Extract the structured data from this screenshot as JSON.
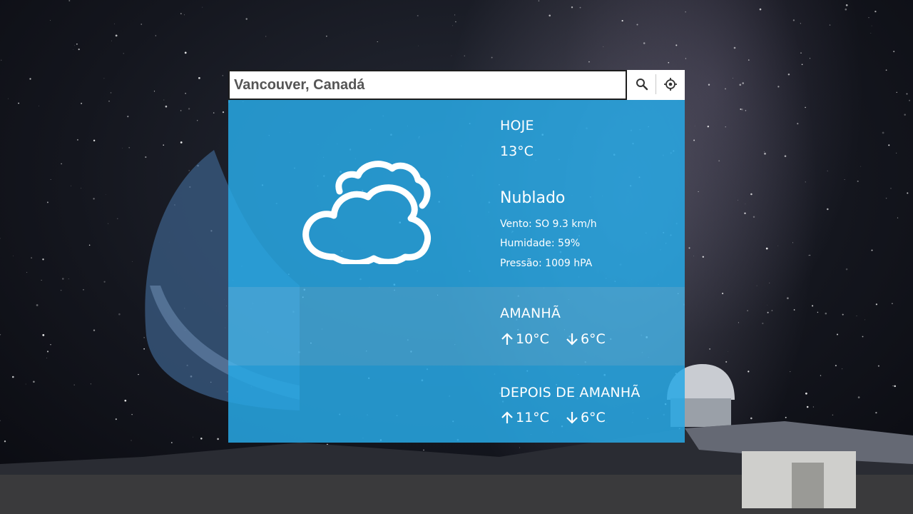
{
  "search": {
    "value": "Vancouver, Canadá",
    "search_icon": "search-icon",
    "locate_icon": "locate-icon"
  },
  "today": {
    "title": "HOJE",
    "temperature": "13°C",
    "condition": "Nublado",
    "icon": "cloud-icon",
    "wind": "Vento: SO 9.3 km/h",
    "humidity": "Humidade: 59%",
    "pressure": "Pressão: 1009 hPA"
  },
  "tomorrow": {
    "title": "AMANHÃ",
    "max": "10°C",
    "min": "6°C"
  },
  "day_after": {
    "title": "DEPOIS DE AMANHÃ",
    "max": "11°C",
    "min": "6°C"
  },
  "colors": {
    "panel": "#28a8e4",
    "panel_light": "#46b6ec",
    "text": "#ffffff"
  }
}
